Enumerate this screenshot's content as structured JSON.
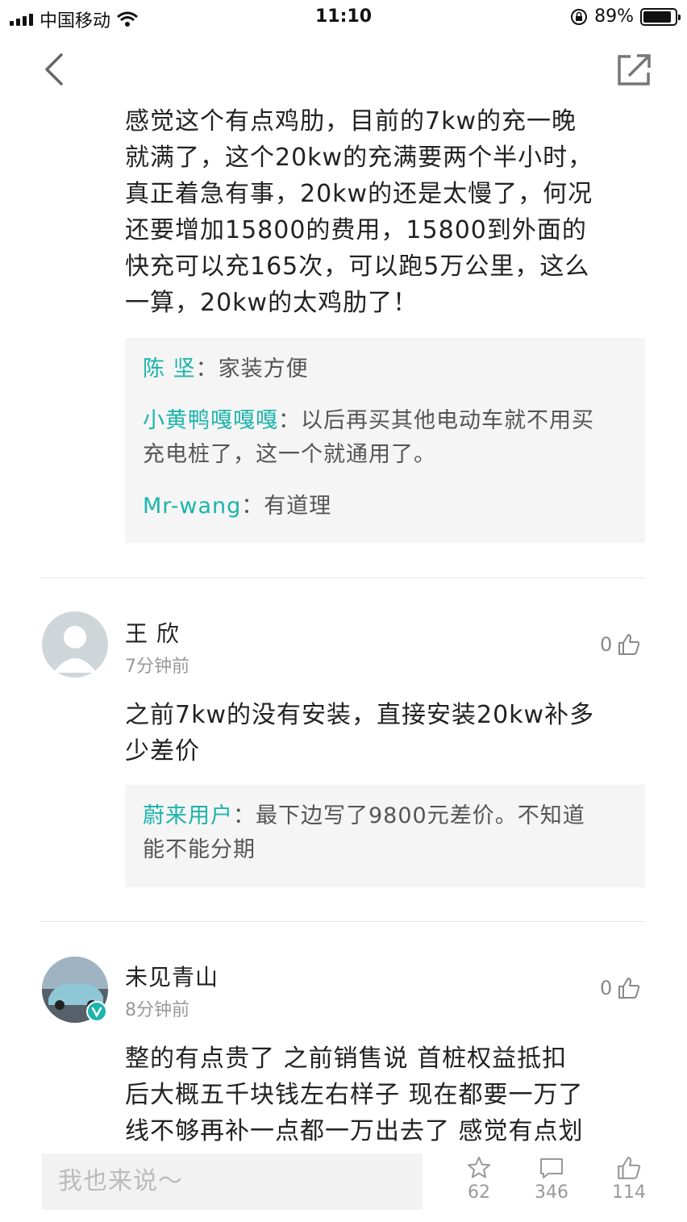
{
  "status_bar": {
    "carrier": "中国移动",
    "time": "11:10",
    "battery": "89%",
    "battery_level": 0.89
  },
  "post": {
    "lines": [
      "感觉这个有点鸡肋，目前的7kw的充一晚",
      "就满了，这个20kw的充满要两个半小时，",
      "真正着急有事，20kw的还是太慢了，何况",
      "还要增加15800的费用，15800到外面的",
      "快充可以充165次，可以跑5万公里，这么",
      "一算，20kw的太鸡肋了！"
    ],
    "replies": [
      {
        "author": "陈 坚",
        "sep": "：",
        "lines": [
          "家装方便"
        ]
      },
      {
        "author": "小黄鸭嘎嘎嘎",
        "sep": "：",
        "lines": [
          "以后再买其他电动车就不用买",
          "充电桩了，这一个就通用了。"
        ]
      },
      {
        "author": "Mr-wang",
        "sep": "：",
        "lines": [
          "有道理"
        ]
      }
    ]
  },
  "comments": [
    {
      "username": "王 欣",
      "time": "7分钟前",
      "likes": "0",
      "lines": [
        "之前7kw的没有安装，直接安装20kw补多",
        "少差价"
      ],
      "replies": [
        {
          "author": "蔚来用户",
          "sep": "：",
          "lines": [
            "最下边写了9800元差价。不知道",
            "能不能分期"
          ]
        }
      ]
    },
    {
      "username": "未见青山",
      "time": "8分钟前",
      "likes": "0",
      "lines": [
        "整的有点贵了 之前销售说 首桩权益抵扣",
        "后大概五千块钱左右样子 现在都要一万了",
        "线不够再补一点都一万出去了 感觉有点划"
      ]
    }
  ],
  "bottom_bar": {
    "placeholder": "我也来说～",
    "favorites": "62",
    "comments": "346",
    "likes": "114"
  }
}
